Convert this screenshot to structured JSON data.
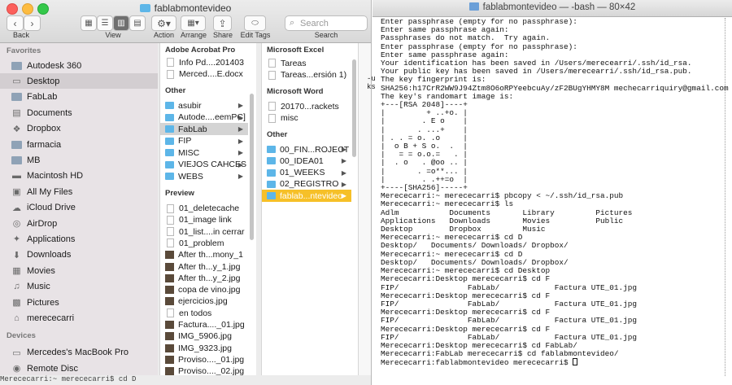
{
  "finder": {
    "title": "fablabmontevideo",
    "toolbar": {
      "back_label": "Back",
      "view_label": "View",
      "action_label": "Action",
      "arrange_label": "Arrange",
      "share_label": "Share",
      "edit_tags_label": "Edit Tags",
      "search_label": "Search",
      "search_placeholder": "Search"
    },
    "sidebar": {
      "favorites_header": "Favorites",
      "devices_header": "Devices",
      "favorites": [
        {
          "label": "Autodesk 360",
          "icon": "folder-icon"
        },
        {
          "label": "Desktop",
          "icon": "desktop-icon",
          "selected": true
        },
        {
          "label": "FabLab",
          "icon": "folder-icon"
        },
        {
          "label": "Documents",
          "icon": "documents-icon"
        },
        {
          "label": "Dropbox",
          "icon": "dropbox-icon"
        },
        {
          "label": "farmacia",
          "icon": "folder-icon"
        },
        {
          "label": "MB",
          "icon": "folder-icon"
        },
        {
          "label": "Macintosh HD",
          "icon": "harddisk-icon"
        },
        {
          "label": "All My Files",
          "icon": "all-files-icon"
        },
        {
          "label": "iCloud Drive",
          "icon": "cloud-icon"
        },
        {
          "label": "AirDrop",
          "icon": "airdrop-icon"
        },
        {
          "label": "Applications",
          "icon": "applications-icon"
        },
        {
          "label": "Downloads",
          "icon": "downloads-icon"
        },
        {
          "label": "Movies",
          "icon": "movies-icon"
        },
        {
          "label": "Music",
          "icon": "music-icon"
        },
        {
          "label": "Pictures",
          "icon": "pictures-icon"
        },
        {
          "label": "merececarri",
          "icon": "home-icon"
        }
      ],
      "devices": [
        {
          "label": "Mercedes's MacBook Pro",
          "icon": "laptop-icon"
        },
        {
          "label": "Remote Disc",
          "icon": "disc-icon"
        }
      ]
    },
    "column1": {
      "header_acrobat": "Adobe Acrobat Pro",
      "acrobat_items": [
        "Info Pd....201403",
        "Merced....E.docx"
      ],
      "header_other": "Other",
      "other_items": [
        {
          "label": "asubir",
          "arrow": true
        },
        {
          "label": "Autode....eemPC]",
          "arrow": true
        },
        {
          "label": "FabLab",
          "arrow": true,
          "selected": true
        },
        {
          "label": "FIP",
          "arrow": true
        },
        {
          "label": "MISC",
          "arrow": true
        },
        {
          "label": "VIEJOS CAHCES",
          "arrow": true
        },
        {
          "label": "WEBS",
          "arrow": true
        }
      ],
      "header_preview": "Preview",
      "preview_items": [
        {
          "label": "01_deletecache",
          "kind": "doc"
        },
        {
          "label": "01_image link",
          "kind": "doc"
        },
        {
          "label": "01_list....in cerrar",
          "kind": "doc"
        },
        {
          "label": "01_problem",
          "kind": "doc"
        },
        {
          "label": "After th...mony_1",
          "kind": "img"
        },
        {
          "label": "After th...y_1.jpg",
          "kind": "img"
        },
        {
          "label": "After th...y_2.jpg",
          "kind": "img"
        },
        {
          "label": "copa de vino.jpg",
          "kind": "img"
        },
        {
          "label": "ejercicios.jpg",
          "kind": "img"
        },
        {
          "label": "en todos",
          "kind": "doc"
        },
        {
          "label": "Factura...._01.jpg",
          "kind": "img"
        },
        {
          "label": "IMG_5906.jpg",
          "kind": "img"
        },
        {
          "label": "IMG_9323.jpg",
          "kind": "img"
        },
        {
          "label": "Proviso...._01.jpg",
          "kind": "img"
        },
        {
          "label": "Proviso...._02.jpg",
          "kind": "img"
        }
      ]
    },
    "column2": {
      "header_excel": "Microsoft Excel",
      "excel_items": [
        "Tareas",
        "Tareas...ersión 1)"
      ],
      "header_word": "Microsoft Word",
      "word_items": [
        "20170...rackets",
        "misc"
      ],
      "header_other": "Other",
      "other_items": [
        {
          "label": "00_FIN...ROJECT",
          "arrow": true
        },
        {
          "label": "00_IDEA01",
          "arrow": true
        },
        {
          "label": "01_WEEKS",
          "arrow": true
        },
        {
          "label": "02_REGISTRO",
          "arrow": true
        },
        {
          "label": "fablab...ntevideo",
          "arrow": true,
          "highlighted": true
        }
      ]
    },
    "bottom_strip": "Merececarri:~ merececarri$ cd D"
  },
  "terminal": {
    "title": "fablabmontevideo — -bash — 80×42",
    "behind_fragments": [
      "-u",
      "ks"
    ],
    "lines": [
      "Enter passphrase (empty for no passphrase):",
      "Enter same passphrase again:",
      "Passphrases do not match.  Try again.",
      "Enter passphrase (empty for no passphrase):",
      "Enter same passphrase again:",
      "Your identification has been saved in /Users/merecearri/.ssh/id_rsa.",
      "Your public key has been saved in /Users/merecearri/.ssh/id_rsa.pub.",
      "The key fingerprint is:",
      "SHA256:h17CrR2WW9J94Ztm8O6oRPYeebcuAy/zF2BUgYHMY8M mechecarriquiry@gmail.com",
      "The key's randomart image is:",
      "+---[RSA 2048]----+",
      "|         + ..+o. |",
      "|        . E o    |",
      "|       . ...+    |",
      "| . . = o. .o     |",
      "|  o B + S o.  .  |",
      "|   = = o.o.=   . |",
      "|  . o   . @oo .. |",
      "|       . =o**... |",
      "|        . .++=o  |",
      "+----[SHA256]-----+",
      "Merececarri:~ merececarri$ pbcopy < ~/.ssh/id_rsa.pub",
      "Merececarri:~ merececarri$ ls",
      "Adlm           Documents       Library         Pictures",
      "Applications   Downloads       Movies          Public",
      "Desktop        Dropbox         Music",
      "Merececarri:~ merececarri$ cd D",
      "Desktop/   Documents/ Downloads/ Dropbox/",
      "Merececarri:~ merececarri$ cd D",
      "Desktop/   Documents/ Downloads/ Dropbox/",
      "Merececarri:~ merececarri$ cd Desktop",
      "Merececarri:Desktop merececarri$ cd F",
      "FIP/               FabLab/            Factura UTE_01.jpg",
      "Merececarri:Desktop merececarri$ cd F",
      "FIP/               FabLab/            Factura UTE_01.jpg",
      "Merececarri:Desktop merececarri$ cd F",
      "FIP/               FabLab/            Factura UTE_01.jpg",
      "Merececarri:Desktop merececarri$ cd F",
      "FIP/               FabLab/            Factura UTE_01.jpg",
      "Merececarri:Desktop merececarri$ cd FabLab/",
      "Merececarri:FabLab merececarri$ cd fablabmontevideo/",
      "Merececarri:fablabmontevideo merececarri$ "
    ]
  },
  "colors": {
    "accent_selection": "#f6c028",
    "folder_blue": "#5db6e8",
    "sidebar_bg": "#e8e3e6"
  }
}
